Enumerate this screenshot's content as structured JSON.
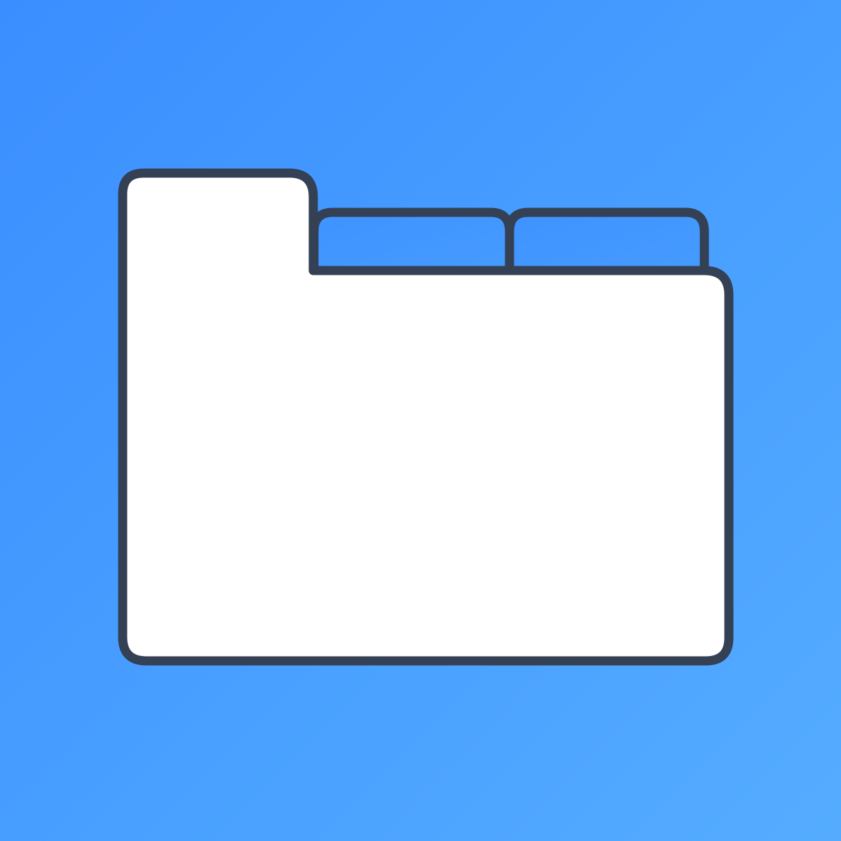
{
  "app_icon": {
    "icon": "folder-icon",
    "tabs": [
      "folder-tab-icon",
      "folder-tab-icon"
    ]
  },
  "colors": {
    "background_start": "#3b8eff",
    "background_end": "#55acff",
    "folder_fill": "#ffffff",
    "tab_fill": "#4196ff",
    "outline": "#344054"
  }
}
